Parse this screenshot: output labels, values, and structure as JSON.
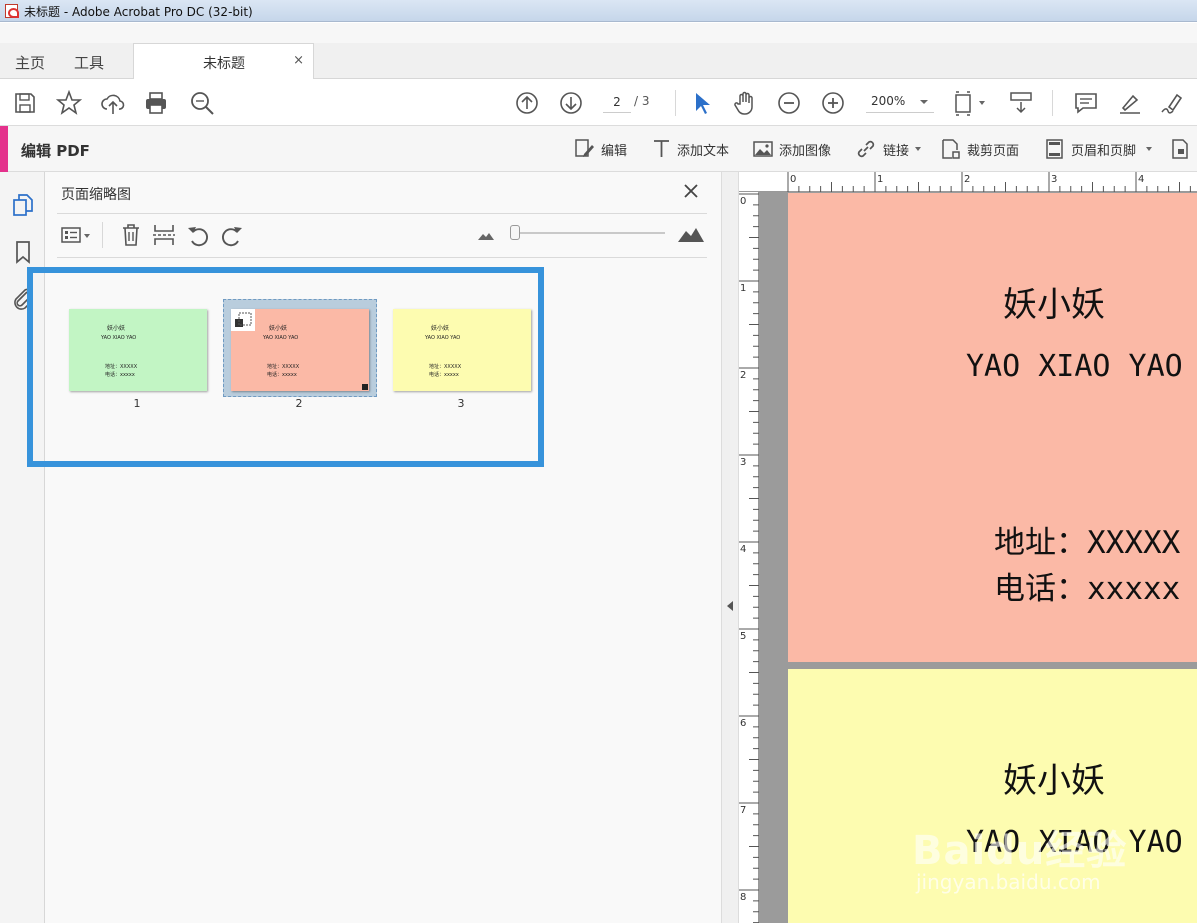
{
  "window": {
    "title": "未标题 - Adobe Acrobat Pro DC (32-bit)"
  },
  "tabs": {
    "home": "主页",
    "tools": "工具",
    "document": "未标题",
    "close": "×"
  },
  "toolbar": {
    "page_current": "2",
    "page_total": "/ 3",
    "zoom": "200%",
    "icons": [
      "save-icon",
      "star-icon",
      "cloud-upload-icon",
      "print-icon",
      "search-icon",
      "arrow-up-circle-icon",
      "arrow-down-circle-icon",
      "select-arrow-icon",
      "hand-icon",
      "zoom-out-icon",
      "zoom-in-icon",
      "fit-page-icon",
      "scroll-mode-icon",
      "comment-icon",
      "highlighter-icon",
      "sign-icon"
    ]
  },
  "edit_bar": {
    "title": "编辑 PDF",
    "items": [
      {
        "label": "编辑",
        "icon": "edit-icon"
      },
      {
        "label": "添加文本",
        "icon": "text-icon"
      },
      {
        "label": "添加图像",
        "icon": "image-icon"
      },
      {
        "label": "链接",
        "icon": "link-icon"
      },
      {
        "label": "裁剪页面",
        "icon": "crop-icon"
      },
      {
        "label": "页眉和页脚",
        "icon": "header-footer-icon"
      }
    ],
    "accent_color": "#e4318c"
  },
  "thumbnail_panel": {
    "title": "页面缩略图",
    "thumbs": [
      {
        "page": "1",
        "name": "妖小妖",
        "en": "YAO XIAO YAO",
        "address": "地址：XXXXX",
        "phone": "电话：xxxxx",
        "color": "#c2f5c4"
      },
      {
        "page": "2",
        "name": "妖小妖",
        "en": "YAO XIAO YAO",
        "address": "地址：XXXXX",
        "phone": "电话：xxxxx",
        "color": "#fbb9a6"
      },
      {
        "page": "3",
        "name": "妖小妖",
        "en": "YAO XIAO YAO",
        "address": "地址：XXXXX",
        "phone": "电话：xxxxx",
        "color": "#fdfcb0"
      }
    ],
    "highlight_color": "#3793db"
  },
  "document": {
    "page2": {
      "name": "妖小妖",
      "en": "YAO XIAO YAO",
      "address_label": "地址：",
      "address_value": "XXXXX",
      "phone_label": "电话：",
      "phone_value": "xxxxx",
      "color": "#fbb9a6"
    },
    "page3": {
      "name": "妖小妖",
      "en": "YAO XIAO YAO",
      "color": "#fdfcb0"
    },
    "ruler_h": [
      "0",
      "1",
      "2",
      "3",
      "4"
    ],
    "ruler_v": [
      "0",
      "1",
      "2",
      "3",
      "4",
      "5",
      "6",
      "7",
      "8"
    ]
  },
  "watermark": {
    "main": "Baidu经验",
    "sub": "jingyan.baidu.com"
  }
}
